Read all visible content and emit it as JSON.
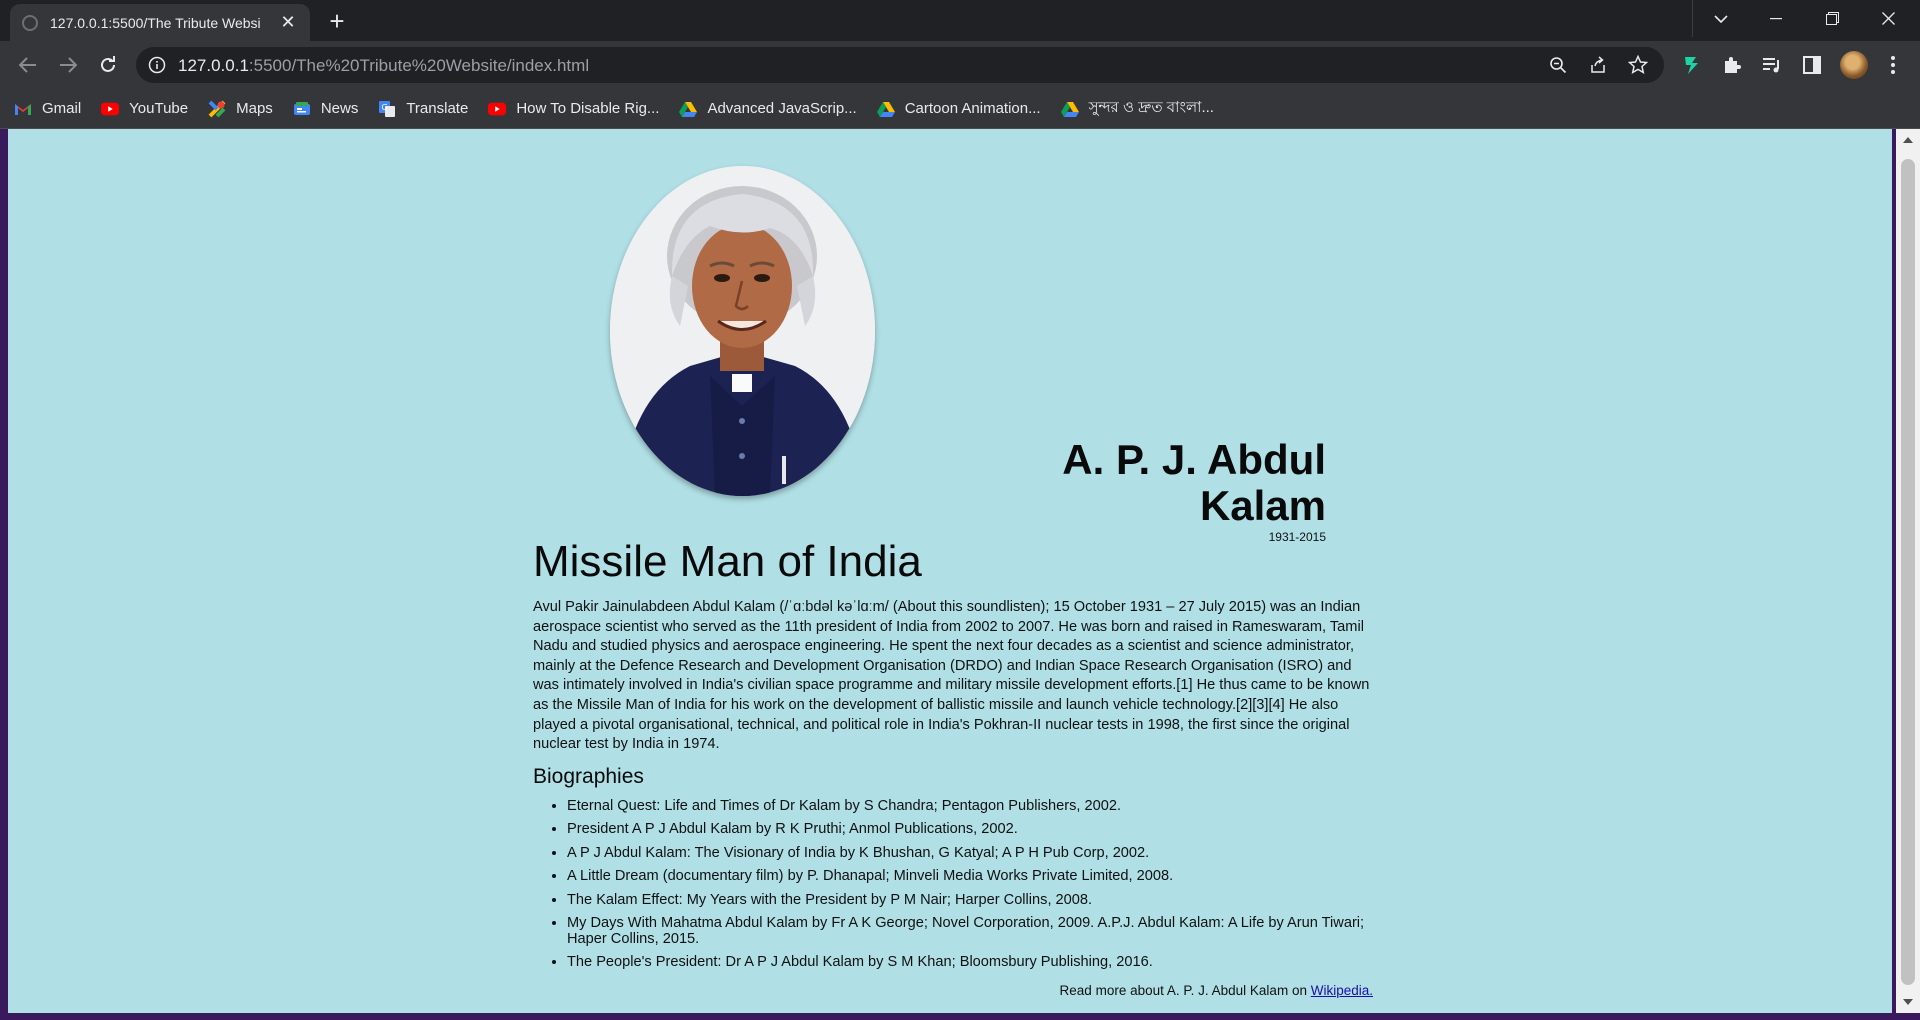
{
  "browser": {
    "tab_title": "127.0.0.1:5500/The Tribute Websi",
    "url_host": "127.0.0.1",
    "url_rest": ":5500/The%20Tribute%20Website/index.html"
  },
  "bookmarks": [
    {
      "label": "Gmail",
      "icon": "gmail-icon"
    },
    {
      "label": "YouTube",
      "icon": "youtube-icon"
    },
    {
      "label": "Maps",
      "icon": "maps-icon"
    },
    {
      "label": "News",
      "icon": "news-icon"
    },
    {
      "label": "Translate",
      "icon": "translate-icon"
    },
    {
      "label": "How To Disable Rig...",
      "icon": "youtube-icon"
    },
    {
      "label": "Advanced JavaScrip...",
      "icon": "google-drive-icon"
    },
    {
      "label": "Cartoon Animation...",
      "icon": "google-drive-icon"
    },
    {
      "label": "সুন্দর ও দ্রুত বাংলা...",
      "icon": "google-drive-icon"
    }
  ],
  "page": {
    "name": "A. P. J. Abdul Kalam",
    "years": "1931-2015",
    "title": "Missile Man of India",
    "intro": "Avul Pakir Jainulabdeen Abdul Kalam (/ˈɑːbdəl kəˈlɑːm/ (About this soundlisten); 15 October 1931 – 27 July 2015) was an Indian aerospace scientist who served as the 11th president of India from 2002 to 2007. He was born and raised in Rameswaram, Tamil Nadu and studied physics and aerospace engineering. He spent the next four decades as a scientist and science administrator, mainly at the Defence Research and Development Organisation (DRDO) and Indian Space Research Organisation (ISRO) and was intimately involved in India's civilian space programme and military missile development efforts.[1] He thus came to be known as the Missile Man of India for his work on the development of ballistic missile and launch vehicle technology.[2][3][4] He also played a pivotal organisational, technical, and political role in India's Pokhran-II nuclear tests in 1998, the first since the original nuclear test by India in 1974.",
    "bio_heading": "Biographies",
    "biographies": [
      "Eternal Quest: Life and Times of Dr Kalam by S Chandra; Pentagon Publishers, 2002.",
      "President A P J Abdul Kalam by R K Pruthi; Anmol Publications, 2002.",
      "A P J Abdul Kalam: The Visionary of India by K Bhushan, G Katyal; A P H Pub Corp, 2002.",
      "A Little Dream (documentary film) by P. Dhanapal; Minveli Media Works Private Limited, 2008.",
      "The Kalam Effect: My Years with the President by P M Nair; Harper Collins, 2008.",
      "My Days With Mahatma Abdul Kalam by Fr A K George; Novel Corporation, 2009. A.P.J. Abdul Kalam: A Life by Arun Tiwari; Haper Collins, 2015.",
      "The People's President: Dr A P J Abdul Kalam by S M Khan; Bloomsbury Publishing, 2016."
    ],
    "readmore_text": "Read more about A. P. J. Abdul Kalam on ",
    "readmore_link": "Wikipedia."
  },
  "colors": {
    "page_bg": "#b0e0e6",
    "frame_bg": "#3a1a5c",
    "chrome_dark": "#202124",
    "chrome_toolbar": "#35363a",
    "link": "#1a0dab"
  }
}
